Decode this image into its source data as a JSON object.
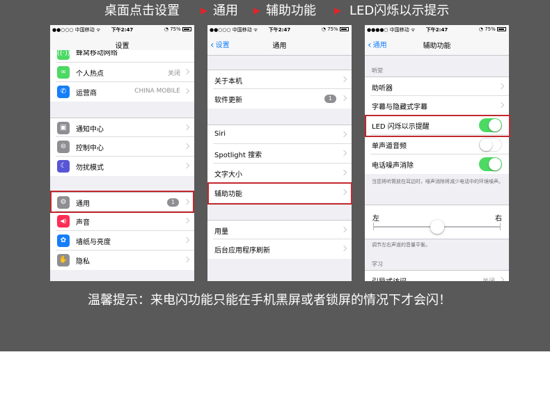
{
  "steps": {
    "step1": "桌面点击设置",
    "step2": "通用",
    "step3": "辅助功能",
    "step4": "LED闪烁以示提示"
  },
  "status": {
    "carrier": "●●○○○ 中国移动 ᯤ",
    "carrier3": "●●●●○ 中国移动 ᯤ",
    "time": "下午2:47",
    "battery": "◔ 75%"
  },
  "screen1": {
    "title": "设置",
    "rows": [
      {
        "label": "蜂窝移动网络",
        "icon": "cellular-icon",
        "color": "#4cd964",
        "glyph": "((·))"
      },
      {
        "label": "个人热点",
        "value": "关闭",
        "icon": "hotspot-icon",
        "color": "#4cd964",
        "glyph": "∞"
      },
      {
        "label": "运营商",
        "value": "CHINA MOBILE",
        "icon": "phone-icon",
        "color": "#147efb",
        "glyph": "✆"
      },
      {
        "label": "通知中心",
        "icon": "notification-icon",
        "color": "#8e8e93",
        "glyph": "▣"
      },
      {
        "label": "控制中心",
        "icon": "control-center-icon",
        "color": "#8e8e93",
        "glyph": "⊜"
      },
      {
        "label": "勿扰模式",
        "icon": "moon-icon",
        "color": "#5856d6",
        "glyph": "☾"
      },
      {
        "label": "通用",
        "badge": "1",
        "icon": "gear-icon",
        "color": "#8e8e93",
        "glyph": "⚙"
      },
      {
        "label": "声音",
        "icon": "speaker-icon",
        "color": "#ff2d55",
        "glyph": "🔊"
      },
      {
        "label": "墙纸与亮度",
        "icon": "flower-icon",
        "color": "#147efb",
        "glyph": "✿"
      },
      {
        "label": "隐私",
        "icon": "hand-icon",
        "color": "#8e8e93",
        "glyph": "✋"
      }
    ]
  },
  "screen2": {
    "back": "设置",
    "title": "通用",
    "rows": [
      {
        "label": "关于本机"
      },
      {
        "label": "软件更新",
        "badge": "1"
      },
      {
        "label": "Siri"
      },
      {
        "label": "Spotlight 搜索"
      },
      {
        "label": "文字大小"
      },
      {
        "label": "辅助功能"
      },
      {
        "label": "用量"
      },
      {
        "label": "后台应用程序刷新"
      }
    ]
  },
  "screen3": {
    "back": "通用",
    "title": "辅助功能",
    "section_hearing": "听觉",
    "rows": [
      {
        "label": "助听器"
      },
      {
        "label": "字幕与隐藏式字幕"
      },
      {
        "label": "LED 闪烁以示提醒",
        "toggle": "on"
      },
      {
        "label": "单声道音频",
        "toggle": "off"
      },
      {
        "label": "电话噪声消除",
        "toggle": "on"
      }
    ],
    "noise_note": "当您将听筒放在耳边时，噪声消除将减少电话中的环境噪声。",
    "balance_left": "左",
    "balance_right": "右",
    "balance_value": 0.5,
    "balance_note": "调节左右声道的音量平衡。",
    "section_learning": "学习",
    "guided_access": "引导式访问",
    "guided_value": "关闭"
  },
  "tip": "温馨提示：来电闪功能只能在手机黑屏或者锁屏的情况下才会闪！",
  "colors": {
    "highlight": "#c1272d",
    "arrow": "#e0242a",
    "toggle_on": "#4cd964",
    "ios_blue": "#147efb"
  }
}
